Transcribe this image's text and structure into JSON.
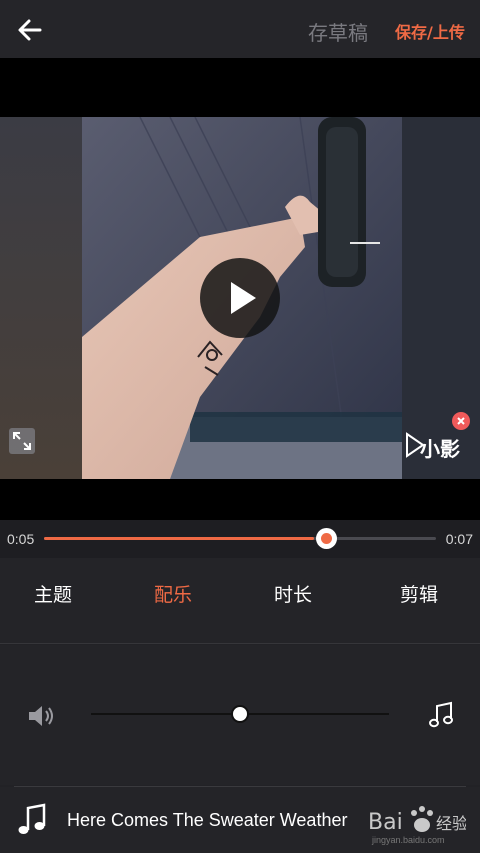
{
  "header": {
    "back_icon": "arrow-left-icon",
    "draft_label": "存草稿",
    "save_label": "保存/上传"
  },
  "player": {
    "play_icon": "play-icon",
    "expand_icon": "expand-icon",
    "watermark_text": "小影",
    "watermark_close_icon": "close-icon"
  },
  "timeline": {
    "current": "0:05",
    "total": "0:07",
    "progress": 0.72
  },
  "tabs": [
    {
      "label": "主题",
      "active": false
    },
    {
      "label": "配乐",
      "active": true
    },
    {
      "label": "时长",
      "active": false
    },
    {
      "label": "剪辑",
      "active": false
    }
  ],
  "volume": {
    "speaker_icon": "speaker-icon",
    "music_icon": "music-note-icon",
    "balance": 0.5
  },
  "song": {
    "icon": "music-note-icon",
    "title": "Here Comes The Sweater Weather"
  },
  "watermark": {
    "site": "jingyan.baidu.com"
  },
  "colors": {
    "accent": "#ef6a45",
    "background": "#242428"
  }
}
